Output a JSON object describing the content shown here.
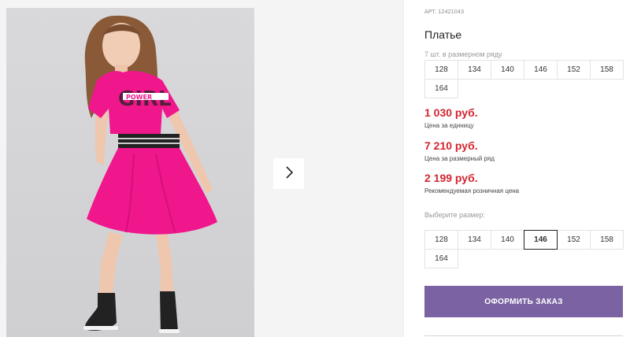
{
  "product": {
    "article": "АРТ. 12421043",
    "title": "Платье",
    "image_alt": "Девочка в розовом платье"
  },
  "size_row": {
    "caption": "7 шт. в размерном ряду",
    "sizes": [
      "128",
      "134",
      "140",
      "146",
      "152",
      "158",
      "164"
    ]
  },
  "prices": [
    {
      "value": "1 030 руб.",
      "caption": "Цена за единицу"
    },
    {
      "value": "7 210 руб.",
      "caption": "Цена за размерный ряд"
    },
    {
      "value": "2 199 руб.",
      "caption": "Рекомендуемая розничная цена"
    }
  ],
  "size_chooser": {
    "label": "Выберите размер:",
    "sizes": [
      "128",
      "134",
      "140",
      "146",
      "152",
      "158",
      "164"
    ],
    "selected": "146"
  },
  "order_button": {
    "label": "ОФОРМИТЬ ЗАКАЗ"
  },
  "print_text": {
    "top": "POWER",
    "bottom": "GIRL"
  },
  "colors": {
    "price": "#d22630",
    "button": "#7b63a3",
    "dress": "#f0168c"
  },
  "icons": {
    "next": "chevron-right-icon"
  }
}
